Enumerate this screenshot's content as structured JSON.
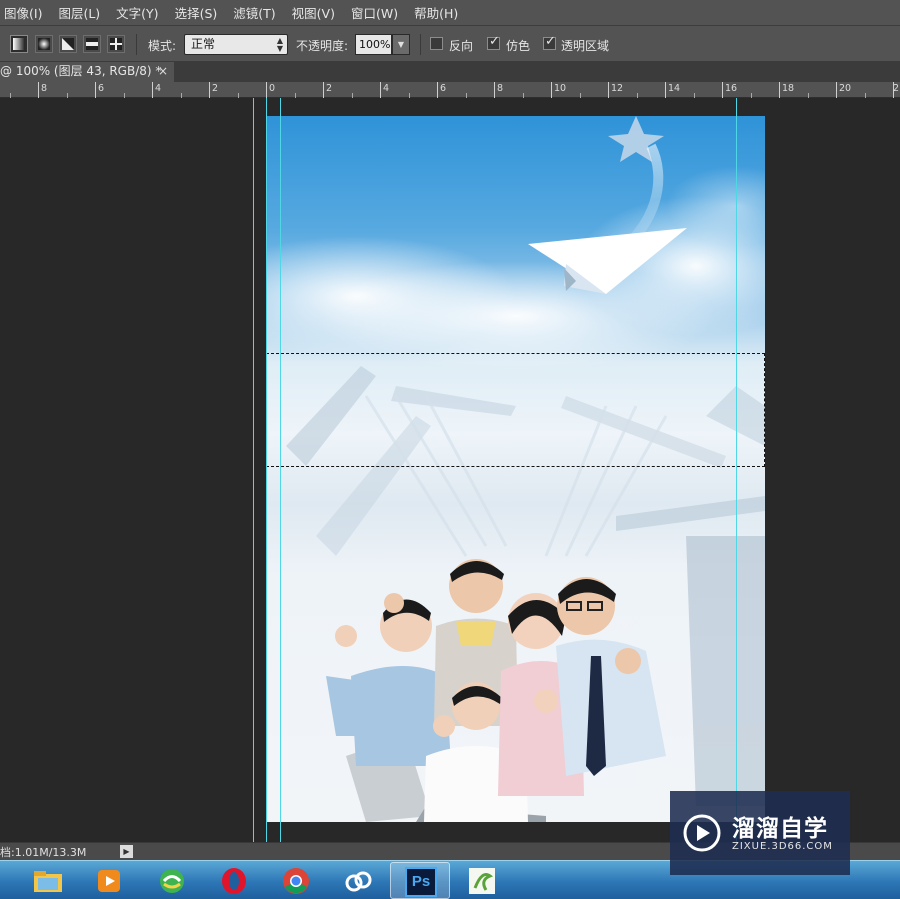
{
  "menu": {
    "items": [
      "图像(I)",
      "图层(L)",
      "文字(Y)",
      "选择(S)",
      "滤镜(T)",
      "视图(V)",
      "窗口(W)",
      "帮助(H)"
    ]
  },
  "options_bar": {
    "gradient_types": [
      "linear-gradient-icon",
      "radial-gradient-icon",
      "angle-gradient-icon",
      "reflected-gradient-icon",
      "diamond-gradient-icon"
    ],
    "mode_label": "模式:",
    "mode_value": "正常",
    "opacity_label": "不透明度:",
    "opacity_value": "100%",
    "reverse_label": "反向",
    "reverse_checked": false,
    "dither_label": "仿色",
    "dither_checked": true,
    "transparency_label": "透明区域",
    "transparency_checked": true
  },
  "document_tab": {
    "title": "@ 100% (图层 43, RGB/8) *",
    "close": "×"
  },
  "ruler": {
    "labels": [
      "8",
      "6",
      "4",
      "2",
      "0",
      "2",
      "4",
      "6",
      "8",
      "10",
      "12",
      "14",
      "16",
      "18",
      "20",
      "2"
    ]
  },
  "status_bar": {
    "doc_size": "档:1.01M/13.3M",
    "arrow": "▶"
  },
  "taskbar": {
    "apps": [
      "file-explorer-icon",
      "media-player-icon",
      "browser-360-icon",
      "opera-icon",
      "chrome-icon",
      "baidu-cloud-icon",
      "photoshop-icon",
      "app-icon"
    ],
    "ps_label": "Ps"
  },
  "watermark": {
    "title": "溜溜自学",
    "url": "ZIXUE.3D66.COM"
  },
  "colors": {
    "accent_guide": "#4fd7e6",
    "ui_panel": "#535353",
    "canvas_bg": "#282828",
    "sky": "#2f93d8"
  }
}
